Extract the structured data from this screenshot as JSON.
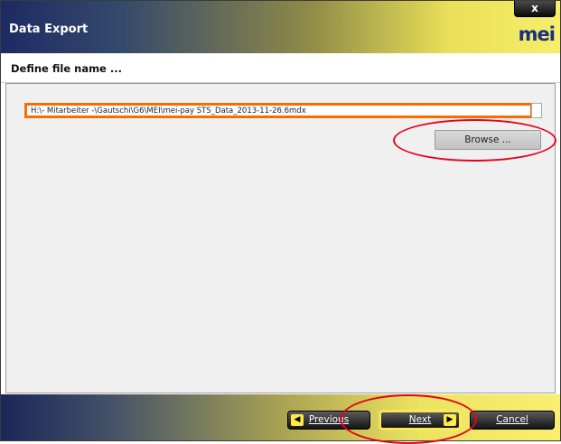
{
  "window": {
    "title": "Data Export",
    "logo_text": "mei",
    "close_symbol": "x"
  },
  "page": {
    "subtitle": "Define file name ..."
  },
  "file_path": {
    "value": "H:\\- Mitarbeiter -\\Gautschi\\G6\\MEI\\mei-pay STS_Data_2013-11-26.6mdx"
  },
  "buttons": {
    "browse_label": "Browse ...",
    "previous_label": "Previous",
    "next_label": "Next",
    "cancel_label": "Cancel"
  },
  "icons": {
    "previous": "chevron-left-icon",
    "next": "chevron-right-icon"
  },
  "colors": {
    "path_highlight": "#ff6a00",
    "annotation": "#e8001a",
    "accent_yellow": "#ffe84a",
    "header_dark": "#1d2a63"
  }
}
